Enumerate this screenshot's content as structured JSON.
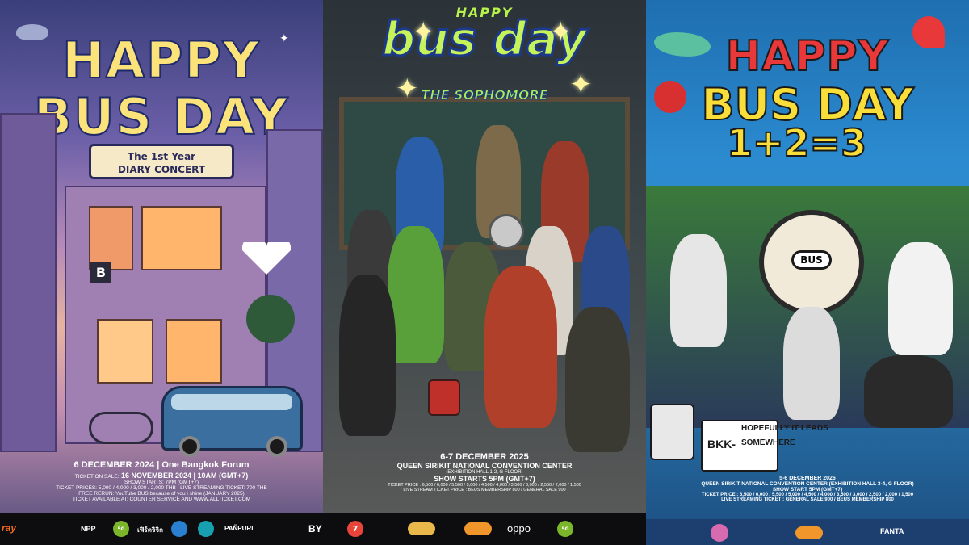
{
  "poster1": {
    "title_line1": "HAPPY",
    "title_line2": "BUS DAY",
    "subtitle_line1": "The 1st Year",
    "subtitle_line2": "DIARY CONCERT",
    "date_venue": "6 DECEMBER 2024 | One Bangkok Forum",
    "ticket_sale_label": "TICKET ON SALE:",
    "ticket_sale": "16 NOVEMBER 2024 | 10AM (GMT+7)",
    "show_starts": "SHOW STARTS: 7PM (GMT+7)",
    "ticket_prices": "TICKET PRICES: 5,000 / 4,000 / 3,000 / 2,000 THB | LIVE STREAMING TICKET: 700 THB",
    "free_rerun": "FREE RERUN: YouTube BUS because of you i shine (JANUARY 2025)",
    "ticket_available": "TICKET AVAILABLE AT: COUNTER SERVICE AND WWW.ALLTICKET.COM",
    "sponsors": [
      "NPP",
      "5G",
      "เฟิร์ตวิจิก",
      "PAÑPURI",
      "BY"
    ]
  },
  "poster2": {
    "happy": "HAPPY",
    "title": "bus day",
    "band": "THE SOPHOMORE",
    "dates": "6-7 DECEMBER 2025",
    "venue": "QUEEN SIRIKIT NATIONAL CONVENTION CENTER",
    "hall": "(EXHIBITION HALL 1-2, G FLOOR)",
    "show_starts": "SHOW STARTS 5PM (GMT+7)",
    "ticket_price": "TICKET PRICE : 6,500 / 6,000 / 5,500 / 5,000 / 4,500 / 4,000 / 3,500 / 3,000 / 2,500 / 2,000 / 1,500",
    "live_stream": "LIVE STREAM TICKET PRICE : BEUS MEMBERSHIP 800 / GENERAL SALE 900",
    "sponsors": [
      "7",
      "oppo",
      "5G"
    ]
  },
  "poster3": {
    "title_line1": "HAPPY",
    "title_line2": "BUS DAY",
    "title_line3": "1+2=3",
    "clock_label": "BUS",
    "tagline_prefix": "BKK-",
    "tagline": "HOPEFULLY IT LEADS SOMEWHERE",
    "dates": "5-6 DECEMBER 2026",
    "venue": "QUEEN SIRIKIT NATIONAL CONVENTION CENTER (EXHIBITION HALL 3-4, G FLOOR)",
    "show_starts": "SHOW START 5PM (GMT+7)",
    "ticket_price": "TICKET PRICE : 6,500 / 6,000 / 5,500 / 5,000 / 4,500 / 4,000 / 3,500 / 3,000 / 2,500 / 2,000 / 1,500",
    "live_stream": "LIVE STREAMING TICKET : GENERAL SALE 900 / BEUS MEMBERSHIP 800",
    "sponsors": [
      "FANTA"
    ]
  },
  "colors": {
    "p1_title": "#fbe37a",
    "p2_title": "#c6f35a",
    "p3_red": "#e8383a",
    "p3_yellow": "#f9de3a"
  }
}
